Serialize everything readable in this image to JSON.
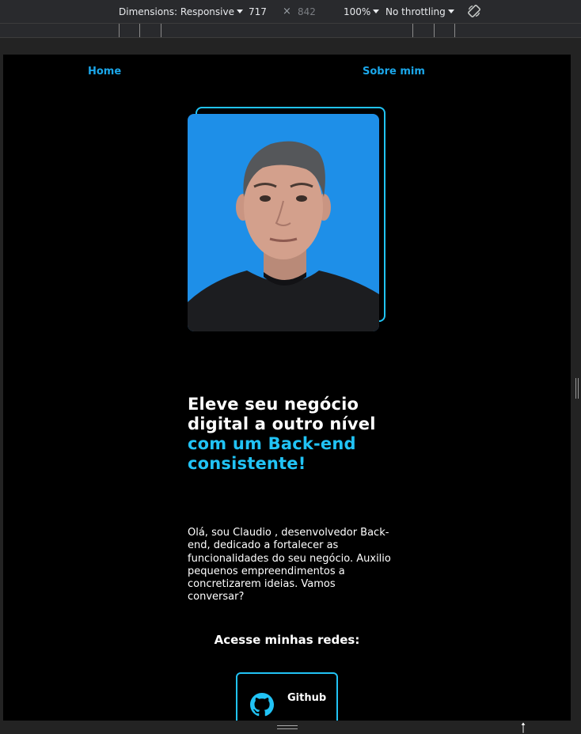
{
  "devtools": {
    "dimensions_label": "Dimensions: Responsive",
    "width": "717",
    "times": "×",
    "height": "842",
    "zoom": "100%",
    "throttling": "No throttling",
    "rotate_icon": "rotate-icon"
  },
  "nav": {
    "home": "Home",
    "about": "Sobre mim"
  },
  "hero": {
    "headline_white": "Eleve seu negócio digital a outro nível",
    "headline_accent": "com um Back-end consistente!",
    "about_text": "Olá, sou Claudio , desenvolvedor Back-end, dedicado a fortalecer as funcionalidades do seu negócio. Auxilio pequenos empreendimentos a concretizarem ideias. Vamos conversar?"
  },
  "social": {
    "title": "Acesse minhas redes:",
    "github_label": "Github",
    "github_icon": "github-icon"
  },
  "colors": {
    "accent": "#21c3f5",
    "nav_link": "#1ba7ea",
    "photo_bg": "#1e8fe8",
    "background": "#000000"
  }
}
